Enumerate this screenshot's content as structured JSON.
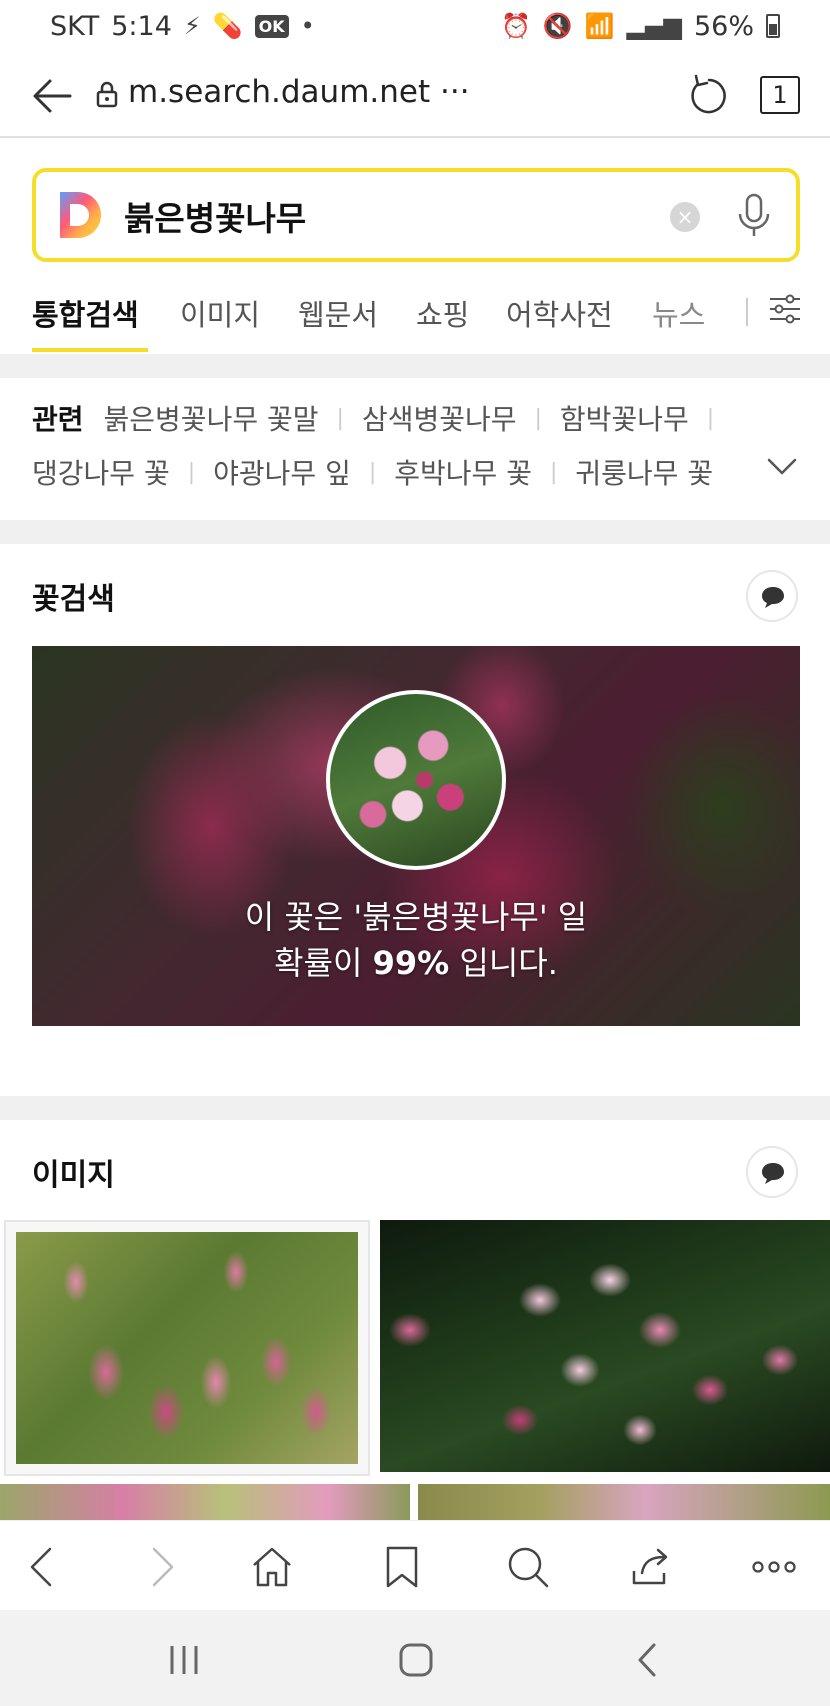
{
  "status_bar": {
    "carrier": "SKT",
    "time": "5:14",
    "notif_ok": "OK",
    "battery": "56%"
  },
  "browser": {
    "url": "m.search.daum.net ···",
    "tab_count": "1"
  },
  "search": {
    "query": "붉은병꽃나무",
    "clear_symbol": "×"
  },
  "tabs": [
    {
      "label": "통합검색",
      "active": true
    },
    {
      "label": "이미지"
    },
    {
      "label": "웹문서"
    },
    {
      "label": "쇼핑"
    },
    {
      "label": "어학사전"
    },
    {
      "label": "뉴스"
    }
  ],
  "related": {
    "label": "관련",
    "row1": [
      "붉은병꽃나무 꽃말",
      "삼색병꽃나무",
      "함박꽃나무"
    ],
    "row2": [
      "댕강나무 꽃",
      "야광나무 잎",
      "후박나무 꽃",
      "귀룽나무 꽃"
    ]
  },
  "flower_search": {
    "title": "꽃검색",
    "result_line1": "이 꽃은 '붉은병꽃나무' 일",
    "result_prefix": "확률이 ",
    "result_prob": "99%",
    "result_suffix": " 입니다."
  },
  "images_section": {
    "title": "이미지"
  },
  "colors": {
    "accent_yellow": "#f6dd2a",
    "text_dark": "#111111",
    "text_gray": "#555555"
  }
}
